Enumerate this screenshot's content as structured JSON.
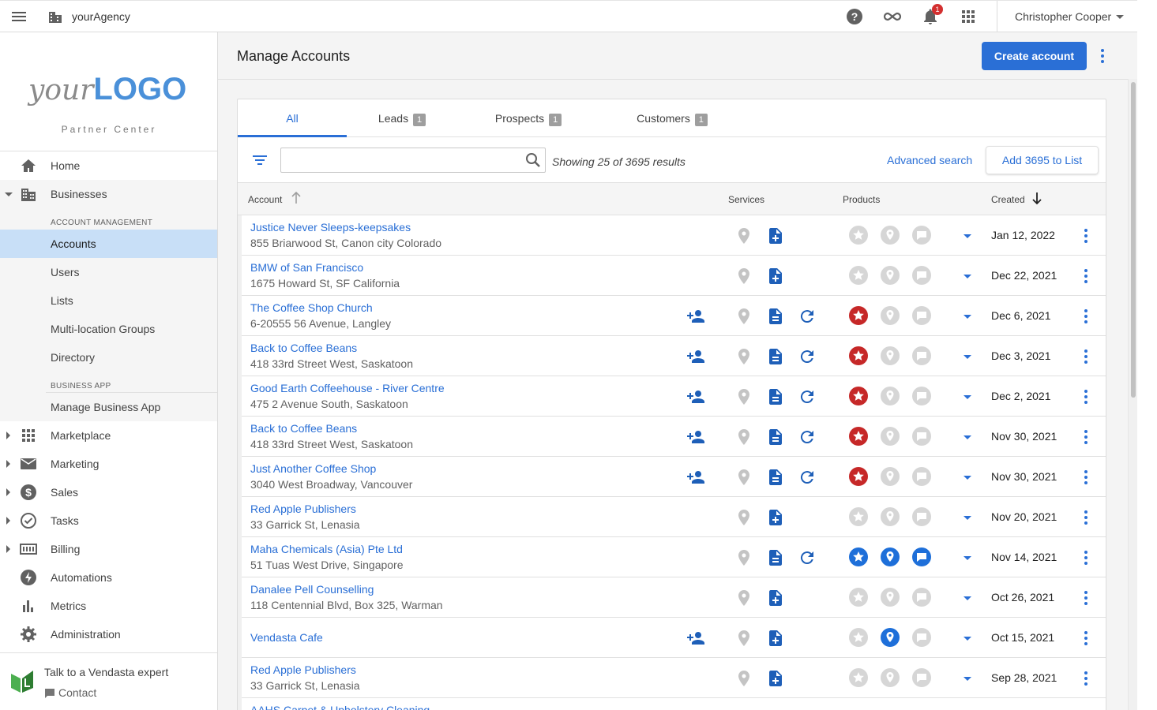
{
  "topbar": {
    "agency": "yourAgency",
    "notification_count": "1",
    "user_name": "Christopher Cooper"
  },
  "sidebar": {
    "logo_text_italic": "your",
    "logo_text_bold": "LOGO",
    "logo_subtitle": "Partner Center",
    "home": "Home",
    "businesses": "Businesses",
    "account_management_header": "ACCOUNT MANAGEMENT",
    "accounts": "Accounts",
    "users": "Users",
    "lists": "Lists",
    "multi_location": "Multi-location Groups",
    "directory": "Directory",
    "business_app_header": "BUSINESS APP",
    "manage_business_app": "Manage Business App",
    "marketplace": "Marketplace",
    "marketing": "Marketing",
    "sales": "Sales",
    "tasks": "Tasks",
    "billing": "Billing",
    "automations": "Automations",
    "metrics": "Metrics",
    "administration": "Administration",
    "talk_title": "Talk to a Vendasta expert",
    "contact": "Contact"
  },
  "page": {
    "title": "Manage Accounts",
    "create_button": "Create account"
  },
  "tabs": [
    {
      "label": "All",
      "count": ""
    },
    {
      "label": "Leads",
      "count": "1"
    },
    {
      "label": "Prospects",
      "count": "1"
    },
    {
      "label": "Customers",
      "count": "1"
    }
  ],
  "filter": {
    "search_placeholder": "",
    "showing": "Showing 25 of 3695 results",
    "advanced_search": "Advanced search",
    "add_to_list": "Add 3695 to List"
  },
  "columns": {
    "account": "Account",
    "services": "Services",
    "products": "Products",
    "created": "Created"
  },
  "colors": {
    "accent_blue": "#2a6fd6",
    "star_active_red": "#c62828",
    "inactive_grey": "#bdbdbd",
    "active_product_blue": "#1e6fd9"
  },
  "rows": [
    {
      "name": "Justice Never Sleeps-keepsakes",
      "address": "855 Briarwood St, Canon city Colorado",
      "date": "Jan 12, 2022",
      "person": false,
      "doc": "doc-add-icon",
      "refresh": false,
      "star": "inactive",
      "pin": "inactive",
      "chat": "inactive"
    },
    {
      "name": "BMW of San Francisco",
      "address": "1675 Howard St, SF California",
      "date": "Dec 22, 2021",
      "person": false,
      "doc": "doc-add-icon",
      "refresh": false,
      "star": "inactive",
      "pin": "inactive",
      "chat": "inactive"
    },
    {
      "name": "The Coffee Shop Church",
      "address": "6-20555 56 Avenue, Langley",
      "date": "Dec 6, 2021",
      "person": true,
      "doc": "doc-icon",
      "refresh": true,
      "star": "red",
      "pin": "inactive",
      "chat": "inactive"
    },
    {
      "name": "Back to Coffee Beans",
      "address": "418 33rd Street West, Saskatoon",
      "date": "Dec 3, 2021",
      "person": true,
      "doc": "doc-icon",
      "refresh": true,
      "star": "red",
      "pin": "inactive",
      "chat": "inactive"
    },
    {
      "name": "Good Earth Coffeehouse - River Centre",
      "address": "475 2 Avenue South, Saskatoon",
      "date": "Dec 2, 2021",
      "person": true,
      "doc": "doc-icon",
      "refresh": true,
      "star": "red",
      "pin": "inactive",
      "chat": "inactive"
    },
    {
      "name": "Back to Coffee Beans",
      "address": "418 33rd Street West, Saskatoon",
      "date": "Nov 30, 2021",
      "person": true,
      "doc": "doc-icon",
      "refresh": true,
      "star": "red",
      "pin": "inactive",
      "chat": "inactive"
    },
    {
      "name": "Just Another Coffee Shop",
      "address": "3040 West Broadway, Vancouver",
      "date": "Nov 30, 2021",
      "person": true,
      "doc": "doc-icon",
      "refresh": true,
      "star": "red",
      "pin": "inactive",
      "chat": "inactive"
    },
    {
      "name": "Red Apple Publishers",
      "address": "33 Garrick St, Lenasia",
      "date": "Nov 20, 2021",
      "person": false,
      "doc": "doc-add-icon",
      "refresh": false,
      "star": "inactive",
      "pin": "inactive",
      "chat": "inactive"
    },
    {
      "name": "Maha Chemicals (Asia) Pte Ltd",
      "address": "51 Tuas West Drive, Singapore",
      "date": "Nov 14, 2021",
      "person": false,
      "doc": "doc-icon",
      "refresh": true,
      "star": "blue",
      "pin": "blue",
      "chat": "blue"
    },
    {
      "name": "Danalee Pell Counselling",
      "address": "118 Centennial Blvd, Box 325, Warman",
      "date": "Oct 26, 2021",
      "person": false,
      "doc": "doc-add-icon",
      "refresh": false,
      "star": "inactive",
      "pin": "inactive",
      "chat": "inactive"
    },
    {
      "name": "Vendasta Cafe",
      "address": "",
      "date": "Oct 15, 2021",
      "person": true,
      "doc": "doc-add-icon",
      "refresh": false,
      "star": "inactive",
      "pin": "blue",
      "chat": "inactive"
    },
    {
      "name": "Red Apple Publishers",
      "address": "33 Garrick St, Lenasia",
      "date": "Sep 28, 2021",
      "person": false,
      "doc": "doc-add-icon",
      "refresh": false,
      "star": "inactive",
      "pin": "inactive",
      "chat": "inactive"
    },
    {
      "name": "AAHS Carpet & Upholstery Cleaning",
      "address": "",
      "date": "",
      "person": false,
      "doc": "",
      "refresh": false,
      "star": "",
      "pin": "",
      "chat": ""
    }
  ]
}
